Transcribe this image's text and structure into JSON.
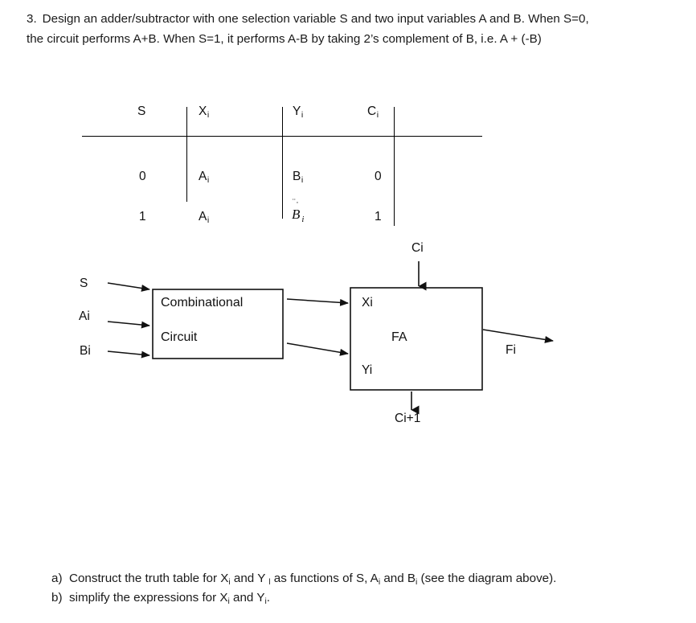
{
  "problem": {
    "number": "3.",
    "line1": "Design an adder/subtractor with one selection variable S and two input variables A and B. When S=0,",
    "line2": "the circuit performs A+B.  When S=1, it performs A-B by taking 2’s complement of B, i.e. A + (-B)"
  },
  "truth_table": {
    "headers": {
      "s": "S",
      "x": "X",
      "x_sub": "i",
      "y": "Y",
      "y_sub": "i",
      "c": "C",
      "c_sub": "i"
    },
    "rows": [
      {
        "s": "0",
        "x": "A",
        "x_sub": "i",
        "y": "B",
        "y_sub": "i",
        "c": "0"
      },
      {
        "s": "1",
        "x": "A",
        "x_sub": "i",
        "y_complement_base": "B",
        "y_complement_overline": "¨·",
        "y_sub": "i",
        "c": "1"
      }
    ]
  },
  "diagram": {
    "inputs": [
      {
        "label": "S"
      },
      {
        "label": "Ai"
      },
      {
        "label": "Bi"
      }
    ],
    "comb_box": {
      "line1": "Combinational",
      "line2": "Circuit"
    },
    "fa_box": {
      "title": "FA",
      "input_x": "Xi",
      "input_y": "Yi",
      "carry_in": "Ci",
      "carry_out": "Ci+1",
      "output": "Fi"
    }
  },
  "questions": [
    {
      "marker": "a)",
      "pre": "Construct the truth table for X",
      "sub1": "i",
      "mid1": " and Y ",
      "sub2": "l",
      "mid2": " as functions of S, A",
      "sub3": "i",
      "mid3": " and B",
      "sub4": "i",
      "post": " (see the diagram above)."
    },
    {
      "marker": "b)",
      "pre": "simplify the expressions for X",
      "sub1": "i",
      "mid1": "  and  Y",
      "sub2": "i",
      "post": "."
    }
  ],
  "colors": {
    "ink": "#000000",
    "text": "#1a1a1a",
    "background": "#ffffff"
  }
}
